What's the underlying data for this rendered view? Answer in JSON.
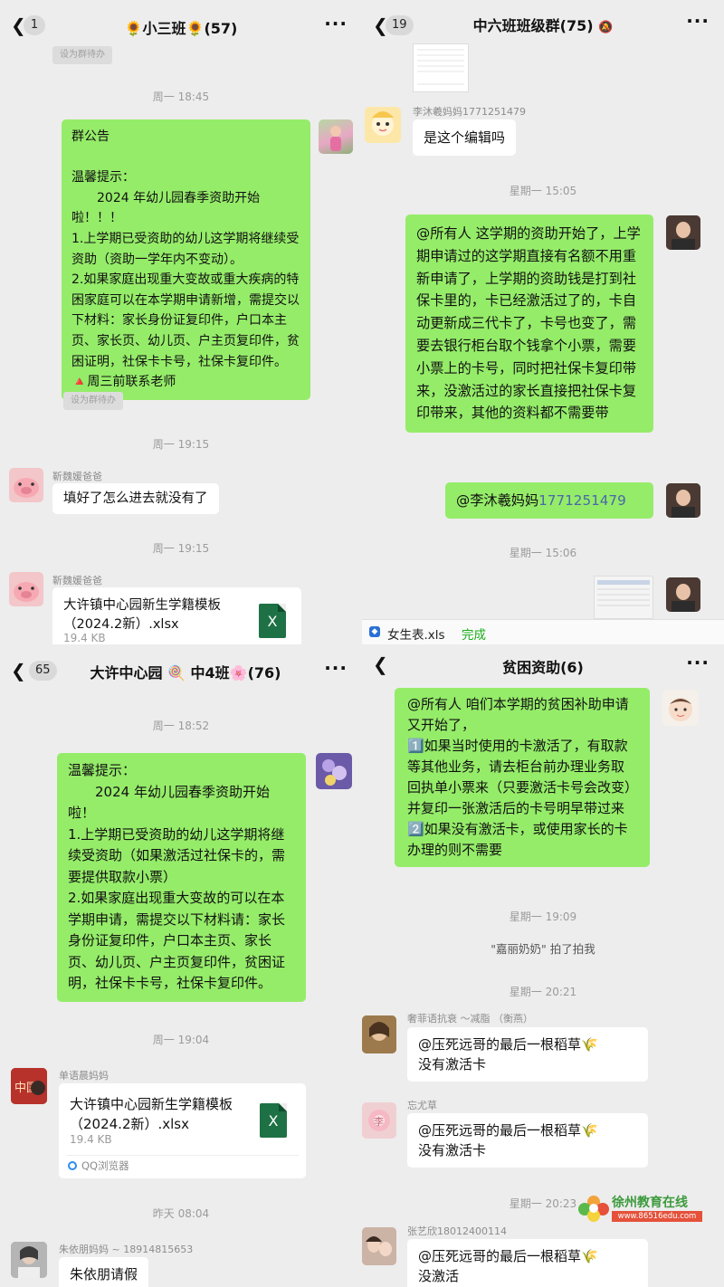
{
  "p1": {
    "header": {
      "badge": "1",
      "title": "🌻小三班🌻(57)"
    },
    "pill_top": "设为群待办",
    "time1": "周一 18:45",
    "announcement": "群公告\n\n温馨提示：\n　　2024 年幼儿园春季资助开始啦！！！\n1.上学期已受资助的幼儿这学期将继续受资助（资助一学年内不变动）。\n2.如果家庭出现重大变故或重大疾病的特困家庭可以在本学期申请新增，需提交以下材料：家长身份证复印件，户口本主页、家长页、幼儿页、户主页复印件，贫困证明，社保卡卡号，社保卡复印件。\n🔺周三前联系老师",
    "pill_bottom": "设为群待办",
    "time2": "周一 19:15",
    "sender1": "靳魏媛爸爸",
    "msg1": "填好了怎么进去就没有了",
    "time3": "周一 19:15",
    "sender2": "靳魏媛爸爸",
    "file_name": "大许镇中心园新生学籍模板（2024.2新）.xlsx",
    "file_size": "19.4 KB",
    "file_icon": "X"
  },
  "p2": {
    "header": {
      "badge": "19",
      "title": "中六班班级群(75)"
    },
    "sender1": "李沐羲妈妈1771251479",
    "msg1": "是这个编辑吗",
    "time1": "星期一 15:05",
    "msg2": "@所有人 这学期的资助开始了，上学期申请过的这学期直接有名额不用重新申请了，上学期的资助钱是打到社保卡里的，卡已经激活过了的，卡自动更新成三代卡了，卡号也变了，需要去银行柜台取个钱拿个小票，需要小票上的卡号，同时把社保卡复印带来，没激活过的家长直接把社保卡复印带来，其他的资料都不需要带",
    "mention_name": "@李沐羲妈妈",
    "mention_num": "1771251479",
    "time2": "星期一 15:06",
    "download_file": "女生表.xls",
    "download_status": "完成"
  },
  "p3": {
    "header": {
      "badge": "65",
      "title": "大许中心园 🍭 中4班🌸(76)"
    },
    "time1": "周一 18:52",
    "msg1": "温馨提示：\n　　2024 年幼儿园春季资助开始啦！\n1.上学期已受资助的幼儿这学期将继续受资助（如果激活过社保卡的，需要提供取款小票）\n2.如果家庭出现重大变故的可以在本学期申请，需提交以下材料请：家长身份证复印件，户口本主页、家长页、幼儿页、户主页复印件，贫困证明，社保卡卡号，社保卡复印件。",
    "time2": "周一 19:04",
    "sender1": "单语晨妈妈",
    "file_name": "大许镇中心园新生学籍模板（2024.2新）.xlsx",
    "file_size": "19.4 KB",
    "file_icon": "X",
    "file_source": "QQ浏览器",
    "time3": "昨天 08:04",
    "sender2": "朱依朋妈妈 ~ 18914815653",
    "msg2": "朱依朋请假"
  },
  "p4": {
    "header": {
      "title": "贫困资助(6)"
    },
    "msg1": "@所有人 咱们本学期的贫困补助申请又开始了，\n1️⃣如果当时使用的卡激活了，有取款等其他业务，请去柜台前办理业务取回执单小票来（只要激活卡号会改变）并复印一张激活后的卡号明早带过来\n2️⃣如果没有激活卡，或使用家长的卡办理的则不需要",
    "time1": "星期一 19:09",
    "sys1": "\"嘉丽奶奶\" 拍了拍我",
    "time2": "星期一 20:21",
    "sender1": "奢菲语抗衰 ～减脂 （衡燕）",
    "msg2": "@压死远哥的最后一根稻草🌾\n没有激活卡",
    "sender2": "忘尤草",
    "msg3": "@压死远哥的最后一根稻草🌾\n没有激活卡",
    "time3": "星期一 20:23",
    "sender3": "张艺欣18012400114",
    "msg4": "@压死远哥的最后一根稻草🌾\n没激活"
  },
  "watermark": {
    "name": "徐州教育在线",
    "url": "www.86516edu.com"
  }
}
